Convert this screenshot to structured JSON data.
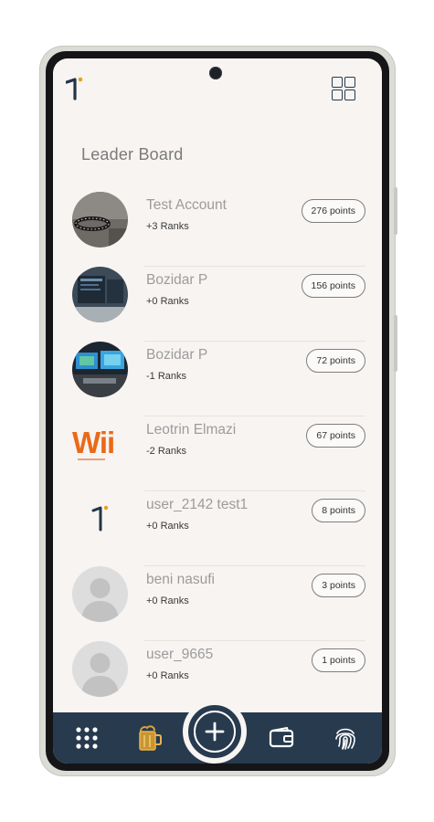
{
  "header": {
    "title": "Leader Board"
  },
  "leaderboard": [
    {
      "name": "Test Account",
      "ranks": "+3 Ranks",
      "points": "276 points",
      "avatar": "photo-dark"
    },
    {
      "name": "Bozidar P",
      "ranks": "+0 Ranks",
      "points": "156 points",
      "avatar": "photo-screens"
    },
    {
      "name": "Bozidar P",
      "ranks": "-1 Ranks",
      "points": "72 points",
      "avatar": "photo-desk"
    },
    {
      "name": "Leotrin Elmazi",
      "ranks": "-2 Ranks",
      "points": "67 points",
      "avatar": "wii-logo"
    },
    {
      "name": "user_2142 test1",
      "ranks": "+0 Ranks",
      "points": "8 points",
      "avatar": "brand-logo"
    },
    {
      "name": "beni nasufi",
      "ranks": "+0 Ranks",
      "points": "3 points",
      "avatar": "default-person"
    },
    {
      "name": "user_9665",
      "ranks": "+0 Ranks",
      "points": "1 points",
      "avatar": "default-person"
    }
  ],
  "bottom_nav": [
    {
      "icon": "grid-dots-icon"
    },
    {
      "icon": "mug-icon",
      "active": true
    },
    {
      "icon": "add-icon"
    },
    {
      "icon": "wallet-icon"
    },
    {
      "icon": "fingerprint-icon"
    }
  ],
  "colors": {
    "navy": "#273a4e",
    "accent": "#e8a11b",
    "bg": "#f7f4f2",
    "wii_orange": "#e96a17"
  },
  "avatar_logo_text": {
    "wii": "Wii"
  }
}
